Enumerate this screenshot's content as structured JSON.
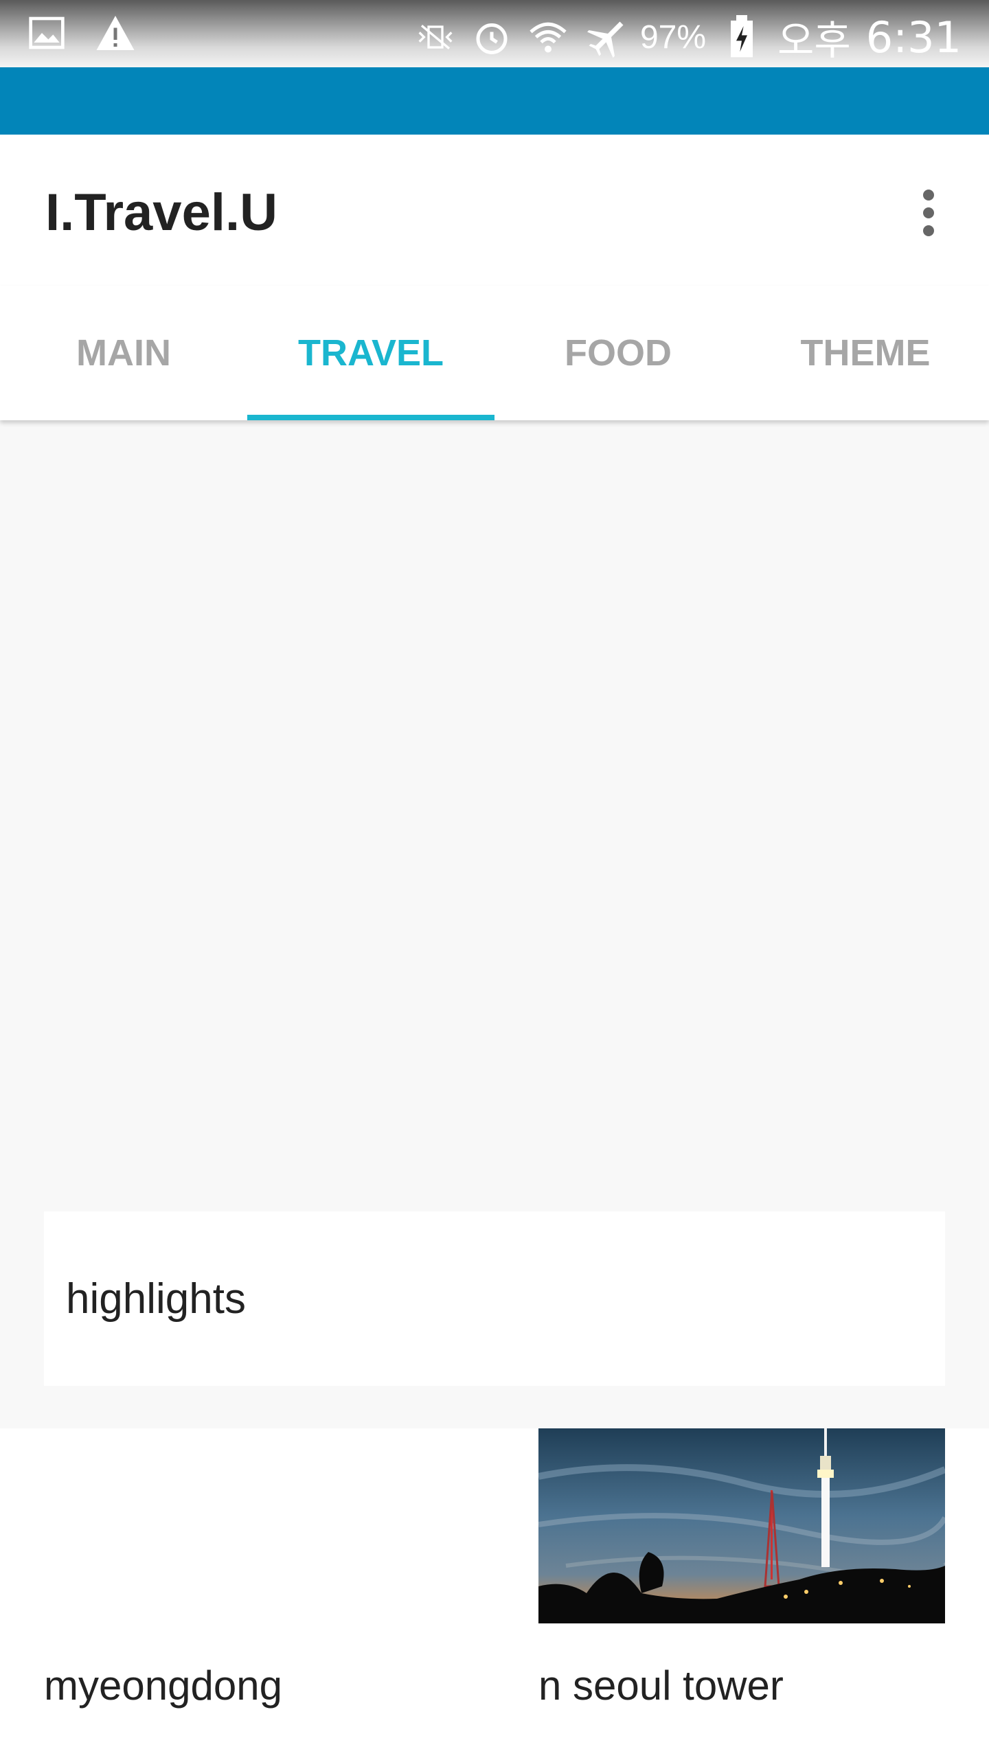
{
  "status_bar": {
    "battery": "97%",
    "ampm": "오후",
    "time": "6:31",
    "icons": [
      "image-notification-icon",
      "warning-icon",
      "vibrate-icon",
      "alarm-icon",
      "wifi-icon",
      "airplane-mode-icon",
      "battery-charging-icon"
    ]
  },
  "app_bar": {
    "title": "I.Travel.U",
    "overflow_icon": "more-vert-icon"
  },
  "tabs": [
    {
      "label": "MAIN",
      "active": false
    },
    {
      "label": "TRAVEL",
      "active": true
    },
    {
      "label": "FOOD",
      "active": false
    },
    {
      "label": "THEME",
      "active": false
    }
  ],
  "highlights": {
    "label": "highlights"
  },
  "places": [
    {
      "name": "myeongdong",
      "has_image": false
    },
    {
      "name": "n seoul tower",
      "has_image": true
    }
  ],
  "colors": {
    "strip": "#0285b9",
    "accent": "#1ab6cf",
    "tab_inactive": "#a6a6a6"
  }
}
